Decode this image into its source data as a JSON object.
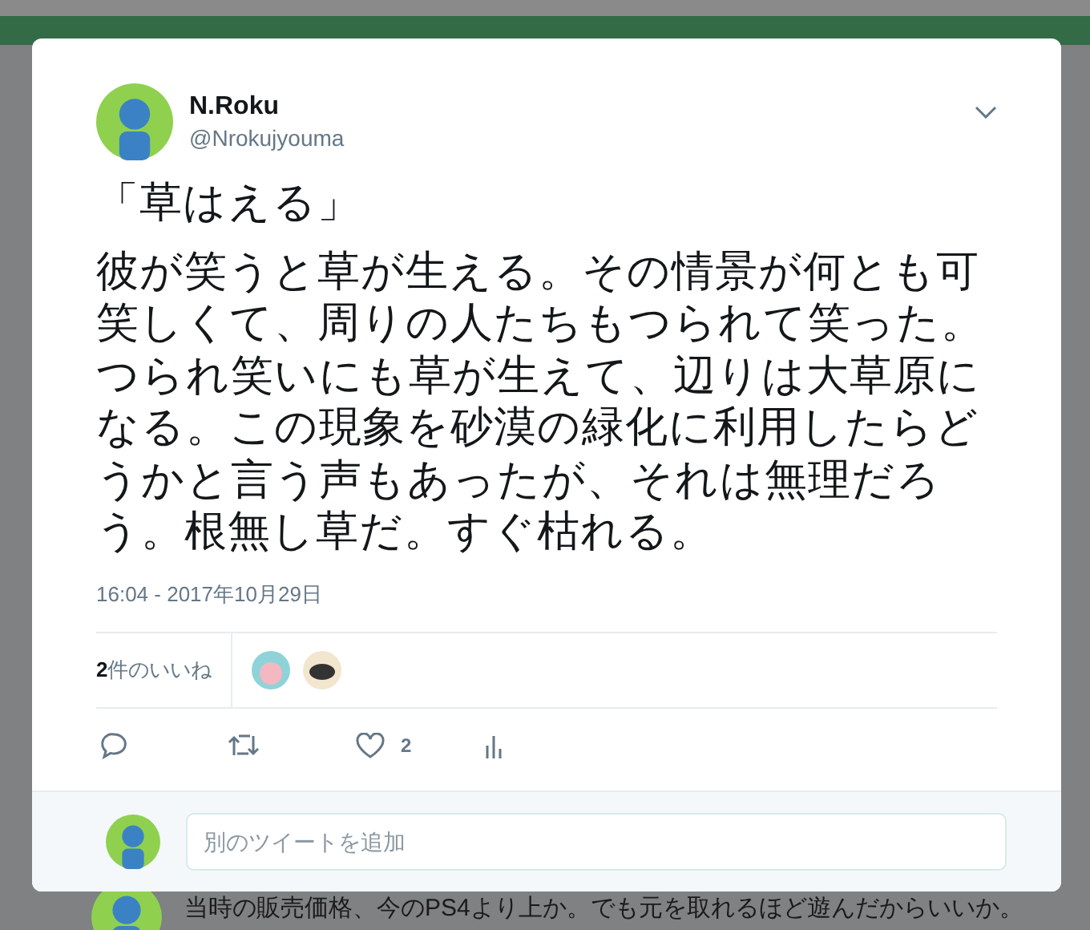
{
  "tweet": {
    "name": "N.Roku",
    "handle": "@Nrokujyouma",
    "title": "「草はえる」",
    "text": "彼が笑うと草が生える。その情景が何とも可笑しくて、周りの人たちもつられて笑った。つられ笑いにも草が生えて、辺りは大草原になる。この現象を砂漠の緑化に利用したらどうかと言う声もあったが、それは無理だろう。根無し草だ。すぐ枯れる。",
    "timestamp": "16:04 - 2017年10月29日",
    "likes_count": "2",
    "likes_label": "件のいいね",
    "like_action_count": "2"
  },
  "reply_box": {
    "placeholder": "別のツイートを追加"
  },
  "background_tweet": {
    "text": "当時の販売価格、今のPS4より上か。でも元を取れるほど遊んだからいいか。"
  }
}
